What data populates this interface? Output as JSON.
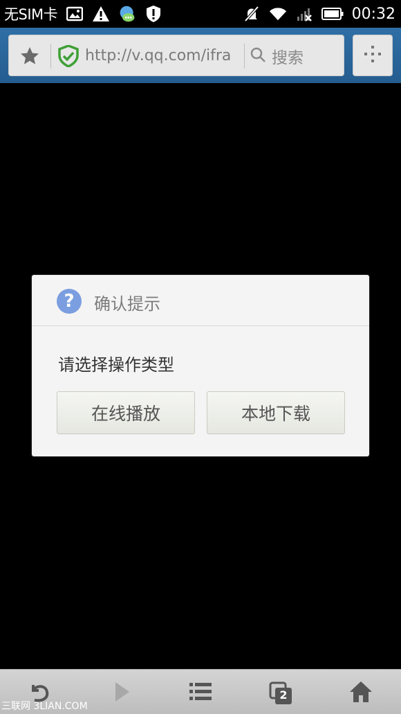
{
  "status_bar": {
    "carrier": "无SIM卡",
    "time": "00:32",
    "icons": [
      "image-icon",
      "warning-icon",
      "chat-app-icon",
      "shield-alert-icon",
      "muted-bell-icon",
      "wifi-icon",
      "no-signal-icon",
      "battery-icon"
    ]
  },
  "toolbar": {
    "url": "http://v.qq.com/ifra",
    "search_placeholder": "搜索",
    "accent_color": "#2f6fa6"
  },
  "dialog": {
    "title": "确认提示",
    "message": "请选择操作类型",
    "buttons": {
      "play_online": "在线播放",
      "download_local": "本地下载"
    }
  },
  "bottom_nav": {
    "tab_count": "2",
    "items": [
      "back-icon",
      "forward-icon",
      "menu-list-icon",
      "tabs-icon",
      "home-icon"
    ]
  },
  "watermark": "三联网 3LIAN.COM"
}
